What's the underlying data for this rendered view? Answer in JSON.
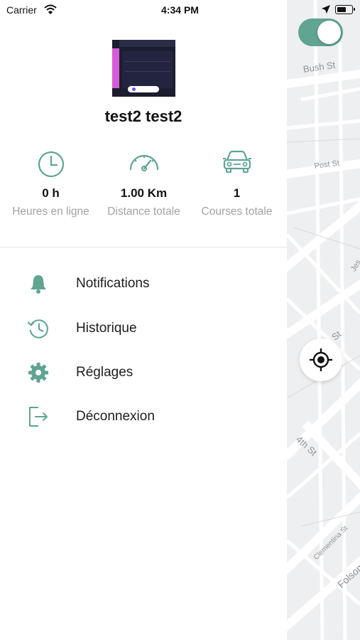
{
  "status_bar": {
    "carrier": "Carrier",
    "time": "4:34 PM"
  },
  "map": {
    "streets": [
      "Bush St",
      "Post St",
      "Jes",
      "St",
      "4th St",
      "Clementina St",
      "Folsom"
    ]
  },
  "toggle": {
    "state": "on"
  },
  "profile": {
    "name": "test2 test2"
  },
  "stats": [
    {
      "value": "0 h",
      "label": "Heures en ligne",
      "icon": "clock-icon"
    },
    {
      "value": "1.00 Km",
      "label": "Distance totale",
      "icon": "speedometer-icon"
    },
    {
      "value": "1",
      "label": "Courses totale",
      "icon": "car-icon"
    }
  ],
  "menu": [
    {
      "label": "Notifications",
      "icon": "bell-icon"
    },
    {
      "label": "Historique",
      "icon": "history-icon"
    },
    {
      "label": "Réglages",
      "icon": "gear-icon"
    },
    {
      "label": "Déconnexion",
      "icon": "logout-icon"
    }
  ],
  "colors": {
    "accent": "#5fa591",
    "muted_text": "#a2a2a2",
    "map_bg": "#eeeff0"
  }
}
